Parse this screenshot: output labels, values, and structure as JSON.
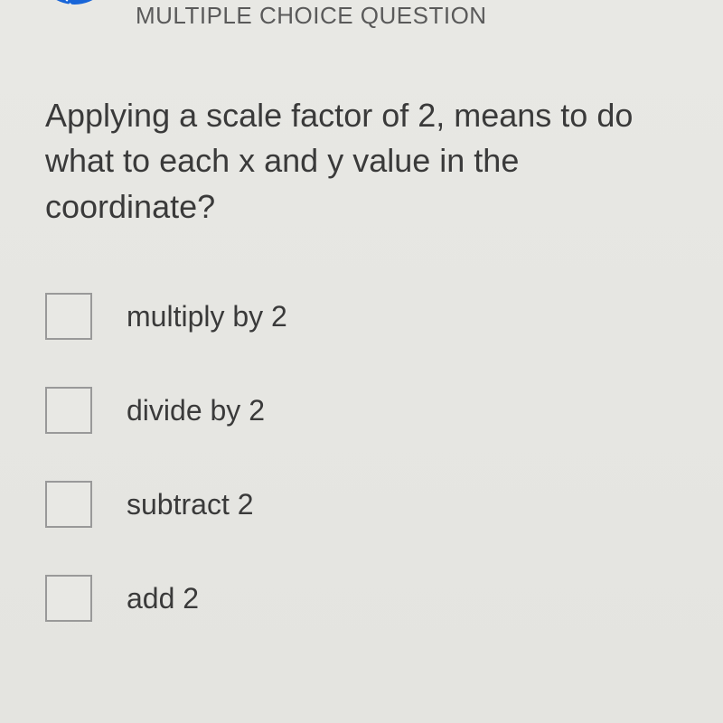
{
  "header": {
    "label": "MULTIPLE CHOICE QUESTION"
  },
  "question": {
    "text": "Applying a scale factor of 2, means to do what to each x and y value in the coordinate?"
  },
  "options": [
    {
      "label": "multiply by 2"
    },
    {
      "label": "divide by 2"
    },
    {
      "label": "subtract 2"
    },
    {
      "label": "add 2"
    }
  ]
}
